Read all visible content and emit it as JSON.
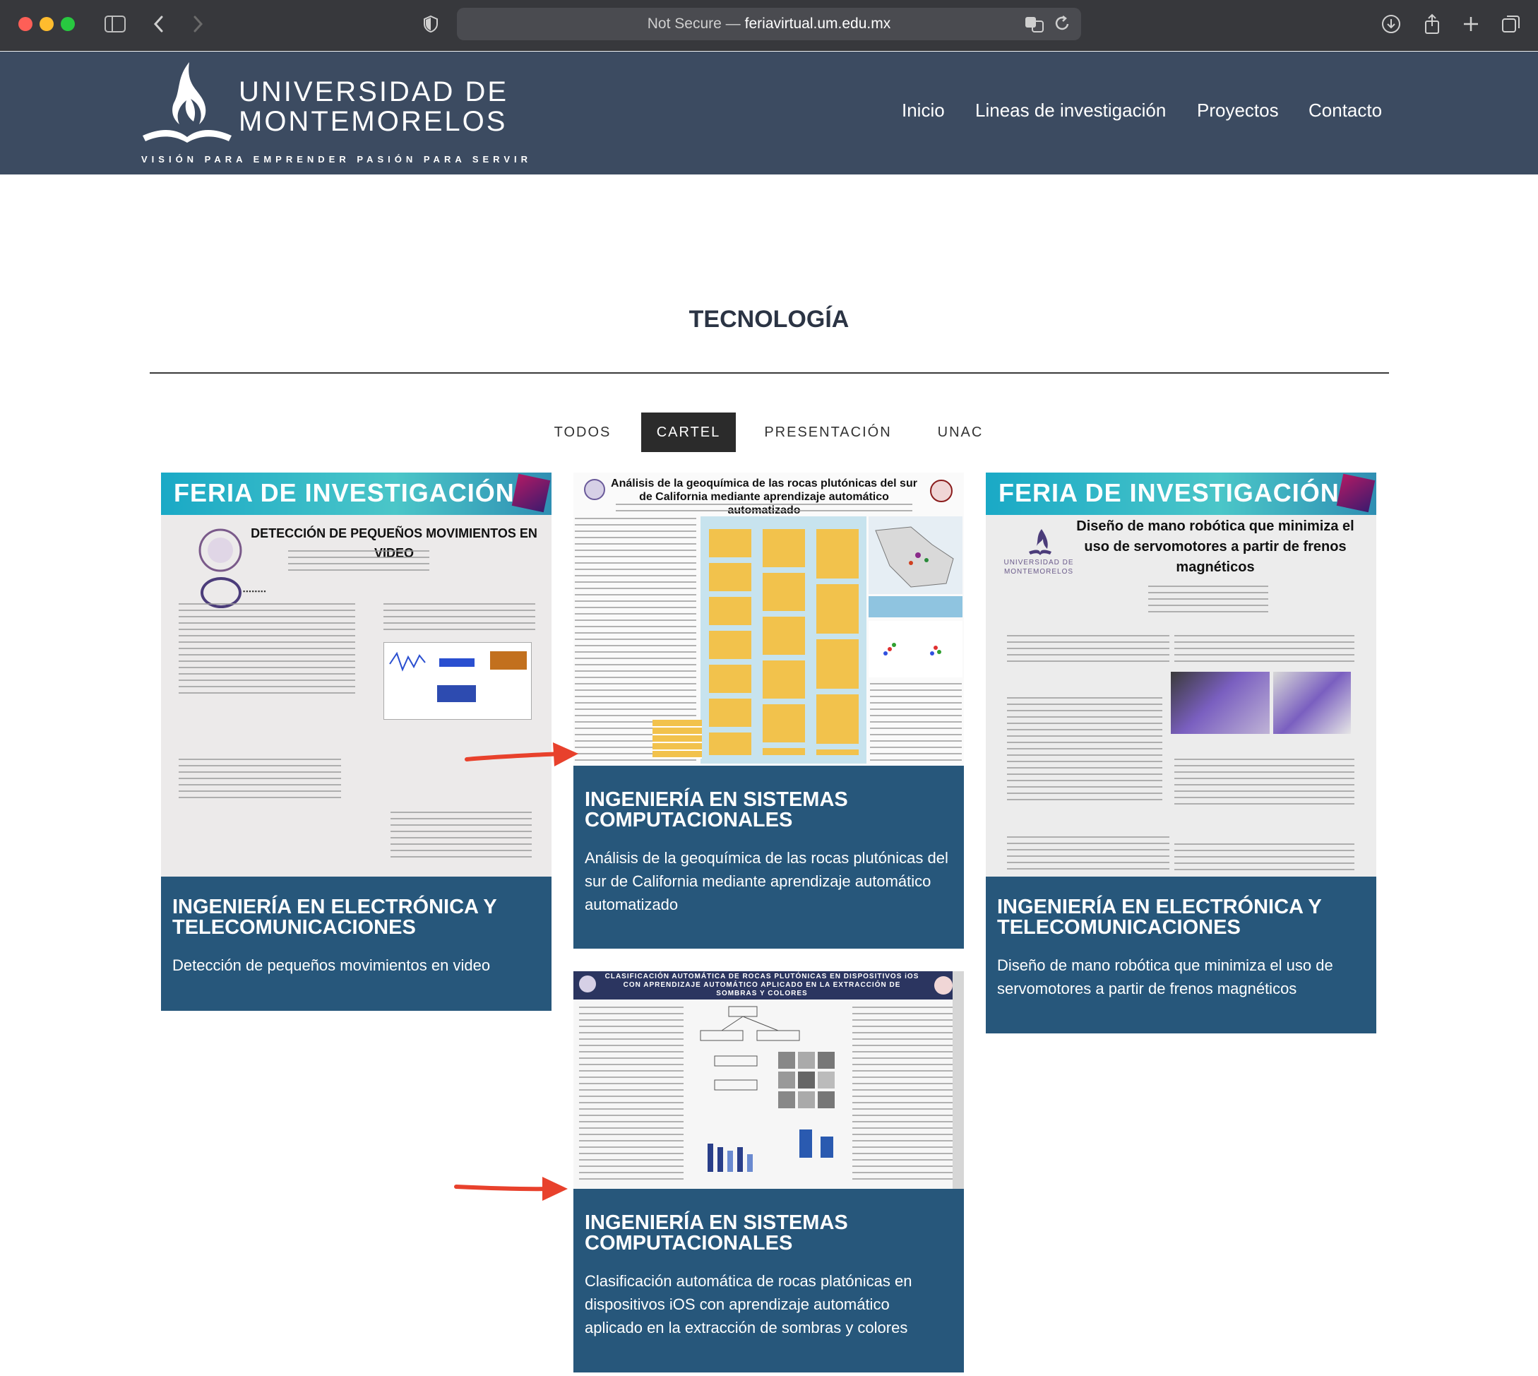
{
  "browser": {
    "url_prefix": "Not Secure —",
    "url_host": "feriavirtual.um.edu.mx"
  },
  "header": {
    "logo_line1": "UNIVERSIDAD DE",
    "logo_line2": "MONTEMORELOS",
    "logo_tagline": "VISIÓN PARA EMPRENDER PASIÓN PARA SERVIR",
    "nav": [
      "Inicio",
      "Lineas de investigación",
      "Proyectos",
      "Contacto"
    ],
    "bg_color": "#3c4b61"
  },
  "main": {
    "title": "TECNOLOGÍA",
    "filters": [
      {
        "label": "TODOS",
        "active": false
      },
      {
        "label": "CARTEL",
        "active": true
      },
      {
        "label": "PRESENTACIÓN",
        "active": false
      },
      {
        "label": "UNAC",
        "active": false
      }
    ]
  },
  "cards": [
    {
      "poster_banner": "FERIA DE INVESTIGACIÓN",
      "poster_title": "DETECCIÓN DE PEQUEÑOS MOVIMIENTOS EN VIDEO",
      "category": "INGENIERÍA EN ELECTRÓNICA Y TELECOMUNICACIONES",
      "description": "Detección de pequeños movimientos en video"
    },
    {
      "poster_title": "Análisis de la geoquímica de las rocas plutónicas del sur de California mediante aprendizaje automático automatizado",
      "category": "INGENIERÍA EN SISTEMAS COMPUTACIONALES",
      "description": "Análisis de la geoquímica de las rocas plutónicas del sur de California mediante aprendizaje automático automatizado"
    },
    {
      "poster_banner": "FERIA DE INVESTIGACIÓN",
      "poster_title": "Diseño de mano robótica que minimiza el uso de servomotores a partir de frenos magnéticos",
      "poster_logo_line1": "UNIVERSIDAD DE",
      "poster_logo_line2": "MONTEMORELOS",
      "category": "INGENIERÍA EN ELECTRÓNICA Y TELECOMUNICACIONES",
      "description": "Diseño de mano robótica que minimiza el uso de servomotores a partir de frenos magnéticos"
    },
    {
      "poster_title": "CLASIFICACIÓN AUTOMÁTICA DE ROCAS PLUTÓNICAS EN DISPOSITIVOS iOS CON APRENDIZAJE AUTOMÁTICO APLICADO EN LA EXTRACCIÓN DE SOMBRAS Y COLORES",
      "category": "INGENIERÍA EN SISTEMAS COMPUTACIONALES",
      "description": "Clasificación automática de rocas platónicas en dispositivos iOS con aprendizaje automático aplicado en la extracción de sombras y colores"
    }
  ],
  "colors": {
    "card_bg": "#27577b",
    "arrow": "#e8412c",
    "active_filter": "#2b2b2b"
  }
}
